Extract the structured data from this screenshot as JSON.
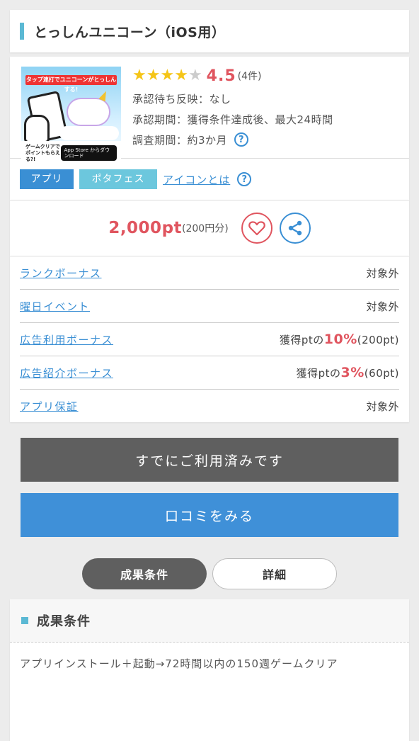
{
  "header": {
    "title": "とっしんユニコーン（iOS用）"
  },
  "offer": {
    "thumbnail": {
      "top_text": "タップ連打でユニコーンがとっしんする!",
      "caption": "ゲームクリアでポイントもらえる?!",
      "store_badge": "App Store からダウンロード"
    },
    "rating": {
      "stars_filled": 4,
      "stars_total": 5,
      "value": "4.5",
      "count": "(4件)"
    },
    "approval_wait": "承認待ち反映：なし",
    "approval_period": "承認期間：獲得条件達成後、最大24時間",
    "survey_period": "調査期間：約3か月",
    "help_icon": "?"
  },
  "tags": {
    "app": "アプリ",
    "pota": "ポタフェス",
    "icon_link": "アイコンとは"
  },
  "points": {
    "main": "2,000pt",
    "yen": "(200円分)",
    "favorite_icon": "heart-icon",
    "share_icon": "share-icon"
  },
  "bonuses": [
    {
      "name": "ランクボーナス",
      "value": "対象外"
    },
    {
      "name": "曜日イベント",
      "value": "対象外"
    },
    {
      "name": "広告利用ボーナス",
      "prefix": "獲得ptの",
      "pct": "10%",
      "suffix": "(200pt)"
    },
    {
      "name": "広告紹介ボーナス",
      "prefix": "獲得ptの",
      "pct": "3%",
      "suffix": "(60pt)"
    },
    {
      "name": "アプリ保証",
      "value": "対象外"
    }
  ],
  "buttons": {
    "used": "すでにご利用済みです",
    "review": "口コミをみる"
  },
  "tabs": {
    "conditions": "成果条件",
    "details": "詳細"
  },
  "conditions": {
    "title": "成果条件",
    "body": "アプリインストール＋起動→72時間以内の150週ゲームクリア"
  },
  "colors": {
    "accent": "#3a8fd4",
    "points": "#e0555f",
    "title_bar": "#5bb9d4",
    "used_button": "#5f5f5f"
  }
}
